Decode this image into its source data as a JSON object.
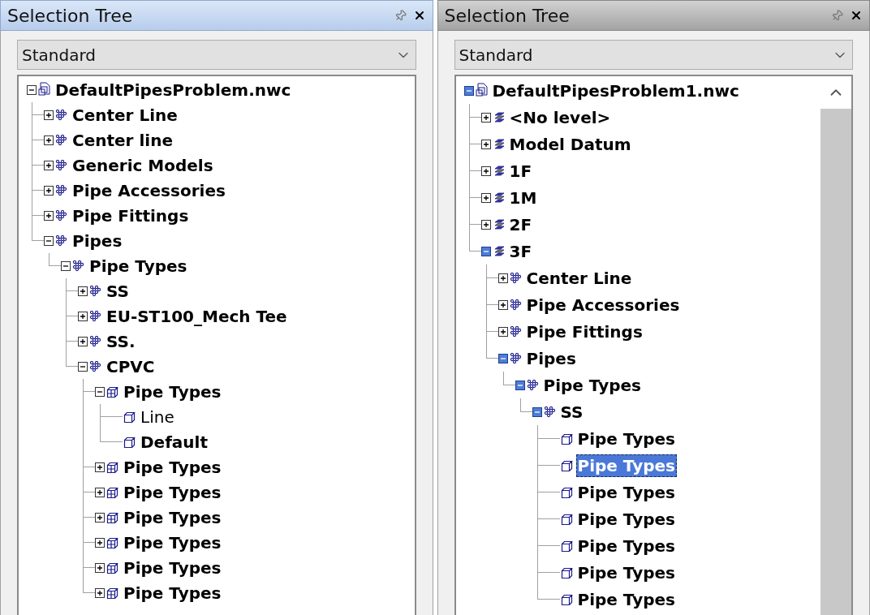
{
  "panels": [
    {
      "title": "Selection Tree",
      "active": true,
      "scrollbar": false,
      "dropdown": {
        "value": "Standard"
      },
      "tree": [
        {
          "label": "DefaultPipesProblem.nwc",
          "kind": "file",
          "expanded": true,
          "selected": false,
          "bold": true,
          "children": [
            {
              "label": "Center Line",
              "kind": "collection",
              "expanded": false,
              "selected": false,
              "bold": true
            },
            {
              "label": "Center line",
              "kind": "collection",
              "expanded": false,
              "selected": false,
              "bold": true
            },
            {
              "label": "Generic Models",
              "kind": "collection",
              "expanded": false,
              "selected": false,
              "bold": true
            },
            {
              "label": "Pipe Accessories",
              "kind": "collection",
              "expanded": false,
              "selected": false,
              "bold": true
            },
            {
              "label": "Pipe Fittings",
              "kind": "collection",
              "expanded": false,
              "selected": false,
              "bold": true
            },
            {
              "label": "Pipes",
              "kind": "collection",
              "expanded": true,
              "selected": false,
              "bold": true,
              "children": [
                {
                  "label": "Pipe Types",
                  "kind": "collection",
                  "expanded": true,
                  "selected": false,
                  "bold": true,
                  "children": [
                    {
                      "label": "SS",
                      "kind": "collection",
                      "expanded": false,
                      "selected": false,
                      "bold": true
                    },
                    {
                      "label": "EU-ST100_Mech Tee",
                      "kind": "collection",
                      "expanded": false,
                      "selected": false,
                      "bold": true
                    },
                    {
                      "label": "SS.",
                      "kind": "collection",
                      "expanded": false,
                      "selected": false,
                      "bold": true
                    },
                    {
                      "label": "CPVC",
                      "kind": "collection",
                      "expanded": true,
                      "selected": false,
                      "bold": true,
                      "children": [
                        {
                          "label": "Pipe Types",
                          "kind": "group",
                          "expanded": true,
                          "selected": false,
                          "bold": true,
                          "children": [
                            {
                              "label": "Line",
                              "kind": "geometry",
                              "selected": false,
                              "bold": false
                            },
                            {
                              "label": "Default",
                              "kind": "geometry",
                              "selected": false,
                              "bold": true
                            }
                          ]
                        },
                        {
                          "label": "Pipe Types",
                          "kind": "group",
                          "expanded": false,
                          "selected": false,
                          "bold": true
                        },
                        {
                          "label": "Pipe Types",
                          "kind": "group",
                          "expanded": false,
                          "selected": false,
                          "bold": true
                        },
                        {
                          "label": "Pipe Types",
                          "kind": "group",
                          "expanded": false,
                          "selected": false,
                          "bold": true
                        },
                        {
                          "label": "Pipe Types",
                          "kind": "group",
                          "expanded": false,
                          "selected": false,
                          "bold": true
                        },
                        {
                          "label": "Pipe Types",
                          "kind": "group",
                          "expanded": false,
                          "selected": false,
                          "bold": true
                        },
                        {
                          "label": "Pipe Types",
                          "kind": "group",
                          "expanded": false,
                          "selected": false,
                          "bold": true
                        }
                      ]
                    }
                  ]
                }
              ]
            }
          ]
        }
      ]
    },
    {
      "title": "Selection Tree",
      "active": false,
      "scrollbar": true,
      "dropdown": {
        "value": "Standard"
      },
      "tree": [
        {
          "label": "DefaultPipesProblem1.nwc",
          "kind": "file",
          "expanded": true,
          "selected": false,
          "bold": true,
          "children": [
            {
              "label": "<No level>",
              "kind": "layer",
              "expanded": false,
              "selected": false,
              "bold": true
            },
            {
              "label": "Model Datum",
              "kind": "layer",
              "expanded": false,
              "selected": false,
              "bold": true
            },
            {
              "label": "1F",
              "kind": "layer",
              "expanded": false,
              "selected": false,
              "bold": true
            },
            {
              "label": "1M",
              "kind": "layer",
              "expanded": false,
              "selected": false,
              "bold": true
            },
            {
              "label": "2F",
              "kind": "layer",
              "expanded": false,
              "selected": false,
              "bold": true
            },
            {
              "label": "3F",
              "kind": "layer",
              "expanded": true,
              "selected": false,
              "bold": true,
              "children": [
                {
                  "label": "Center Line",
                  "kind": "collection",
                  "expanded": false,
                  "selected": false,
                  "bold": true
                },
                {
                  "label": "Pipe Accessories",
                  "kind": "collection",
                  "expanded": false,
                  "selected": false,
                  "bold": true
                },
                {
                  "label": "Pipe Fittings",
                  "kind": "collection",
                  "expanded": false,
                  "selected": false,
                  "bold": true
                },
                {
                  "label": "Pipes",
                  "kind": "collection",
                  "expanded": true,
                  "selected": false,
                  "bold": true,
                  "children": [
                    {
                      "label": "Pipe Types",
                      "kind": "collection",
                      "expanded": true,
                      "selected": false,
                      "bold": true,
                      "children": [
                        {
                          "label": "SS",
                          "kind": "collection",
                          "expanded": true,
                          "selected": false,
                          "bold": true,
                          "children": [
                            {
                              "label": "Pipe Types",
                              "kind": "geometry",
                              "selected": false,
                              "bold": true
                            },
                            {
                              "label": "Pipe Types",
                              "kind": "geometry",
                              "selected": true,
                              "bold": true
                            },
                            {
                              "label": "Pipe Types",
                              "kind": "geometry",
                              "selected": false,
                              "bold": true
                            },
                            {
                              "label": "Pipe Types",
                              "kind": "geometry",
                              "selected": false,
                              "bold": true
                            },
                            {
                              "label": "Pipe Types",
                              "kind": "geometry",
                              "selected": false,
                              "bold": true
                            },
                            {
                              "label": "Pipe Types",
                              "kind": "geometry",
                              "selected": false,
                              "bold": true
                            },
                            {
                              "label": "Pipe Types",
                              "kind": "geometry",
                              "selected": false,
                              "bold": true
                            }
                          ]
                        }
                      ]
                    }
                  ]
                }
              ]
            }
          ]
        }
      ]
    }
  ]
}
